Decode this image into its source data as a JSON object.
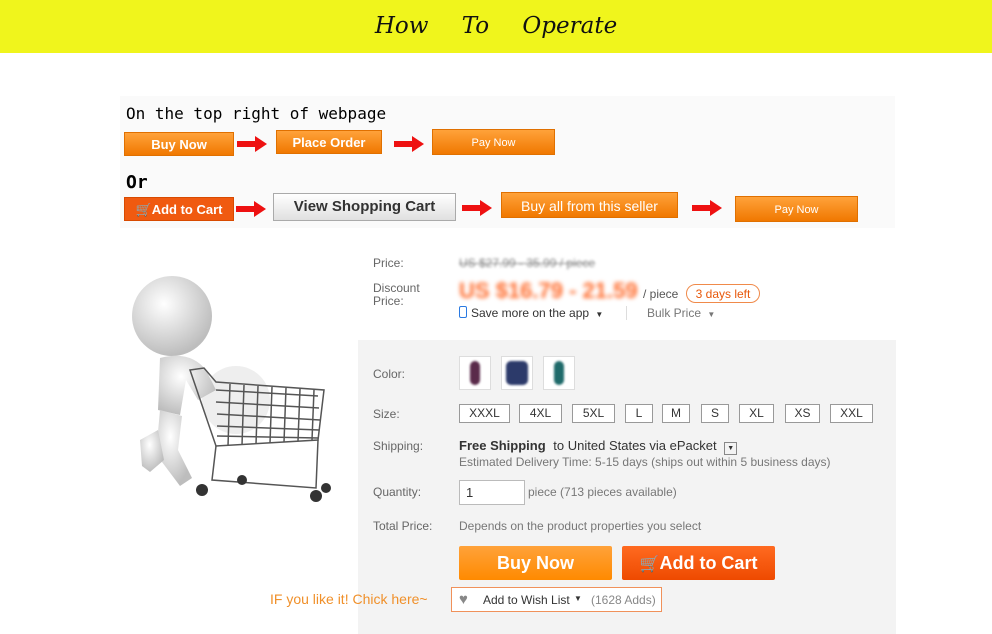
{
  "banner": {
    "title": "How To Operate",
    "color": "#f0f51c"
  },
  "flow": {
    "header_top": "On the top right of webpage",
    "row1": [
      "Buy Now",
      "Place Order",
      "Pay Now"
    ],
    "or_label": "Or",
    "row2": [
      "Add to Cart",
      "View Shopping Cart",
      "Buy all from this seller",
      "Pay Now"
    ],
    "arrow_color": "#ee1111"
  },
  "product": {
    "price_label": "Price:",
    "original_price": "US $27.99 - 35.99 / piece",
    "discount_label_1": "Discount",
    "discount_label_2": "Price:",
    "discount_price": "US $16.79 - 21.59",
    "per_piece": "/ piece",
    "days_left": "3 days left",
    "save_app": "Save more on the app",
    "bulk_price": "Bulk Price",
    "color_label": "Color:",
    "size_label": "Size:",
    "sizes": [
      "XXXL",
      "4XL",
      "5XL",
      "L",
      "M",
      "S",
      "XL",
      "XS",
      "XXL"
    ],
    "shipping_label": "Shipping:",
    "free_shipping": "Free Shipping",
    "shipping_to": "to United States via ePacket",
    "delivery": "Estimated Delivery Time: 5-15 days (ships out within 5 business days)",
    "quantity_label": "Quantity:",
    "quantity_value": "1",
    "pieces_available": "piece (713 pieces available)",
    "total_label": "Total Price:",
    "total_value": "Depends on the product properties you select",
    "buy_now": "Buy Now",
    "add_to_cart": "Add to Cart",
    "wishlist": "Add to Wish List",
    "wishlist_count": "(1628 Adds)",
    "promo": "IF you like it! Chick here~"
  },
  "colors": {
    "orange": "#ff8a00",
    "red_orange": "#f05a10",
    "price": "#ff6a2a"
  }
}
